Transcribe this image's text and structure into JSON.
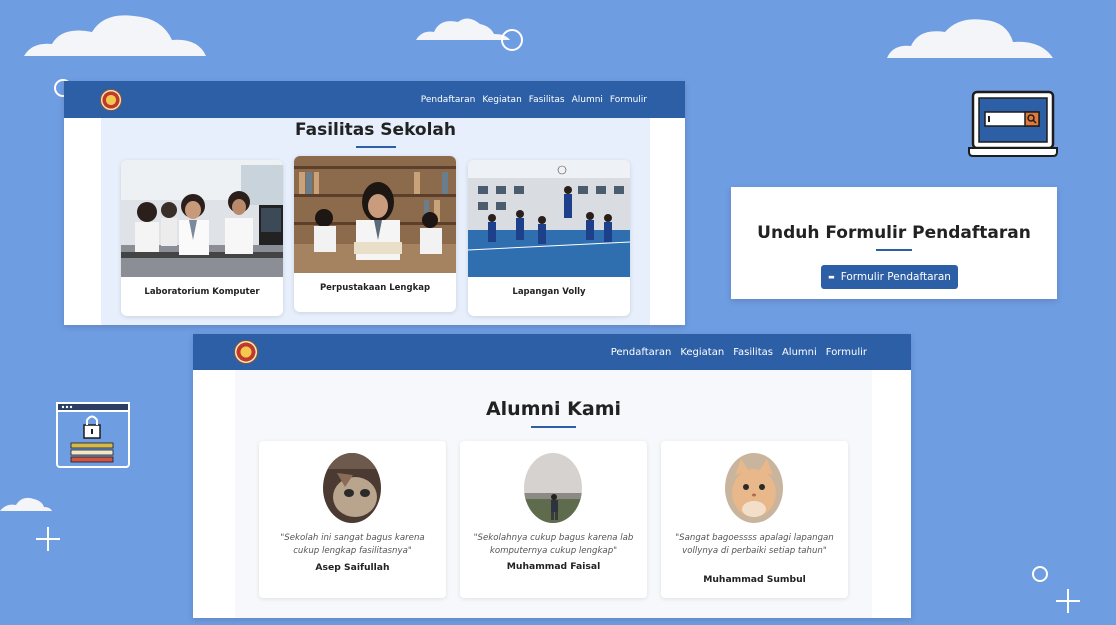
{
  "facilities_window": {
    "nav": [
      "Pendaftaran",
      "Kegiatan",
      "Fasilitas",
      "Alumni",
      "Formulir"
    ],
    "title": "Fasilitas Sekolah",
    "cards": [
      {
        "caption": "Laboratorium Komputer"
      },
      {
        "caption": "Perpustakaan Lengkap"
      },
      {
        "caption": "Lapangan Volly"
      }
    ]
  },
  "download_card": {
    "title": "Unduh Formulir Pendaftaran",
    "button_label": "Formulir Pendaftaran",
    "button_icon": "form-icon"
  },
  "alumni_window": {
    "nav": [
      "Pendaftaran",
      "Kegiatan",
      "Fasilitas",
      "Alumni",
      "Formulir"
    ],
    "title": "Alumni Kami",
    "cards": [
      {
        "quote": "\"Sekolah ini sangat bagus karena cukup lengkap fasilitasnya\"",
        "name": "Asep Saifullah"
      },
      {
        "quote": "\"Sekolahnya cukup bagus karena lab komputernya cukup lengkap\"",
        "name": "Muhammad Faisal"
      },
      {
        "quote": "\"Sangat bagoessss apalagi lapangan vollynya di perbaiki setiap tahun\"",
        "name": "Muhammad Sumbul"
      }
    ]
  },
  "colors": {
    "background": "#6f9de2",
    "navbar": "#2d5fa6",
    "accent": "#2d5fa6"
  },
  "decorations": [
    "cloud-icon",
    "laptop-search-icon",
    "lock-window-icon",
    "plus-icon",
    "circle-icon"
  ]
}
